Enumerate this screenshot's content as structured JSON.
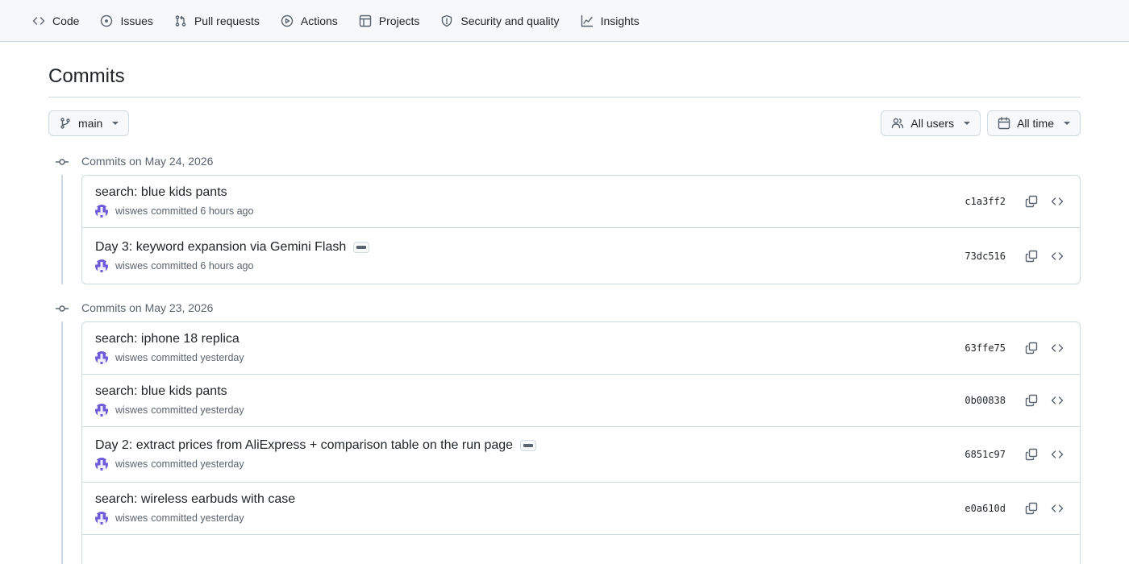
{
  "nav": {
    "items": [
      {
        "label": "Code",
        "icon": "code-icon"
      },
      {
        "label": "Issues",
        "icon": "issue-opened-icon"
      },
      {
        "label": "Pull requests",
        "icon": "git-pull-request-icon"
      },
      {
        "label": "Actions",
        "icon": "play-icon"
      },
      {
        "label": "Projects",
        "icon": "table-icon"
      },
      {
        "label": "Security and quality",
        "icon": "shield-icon"
      },
      {
        "label": "Insights",
        "icon": "graph-icon"
      }
    ]
  },
  "page": {
    "title": "Commits"
  },
  "toolbar": {
    "branch": "main",
    "users_filter": "All users",
    "time_filter": "All time"
  },
  "groups": [
    {
      "header": "Commits on May 24, 2026",
      "commits": [
        {
          "message": "search: blue kids pants",
          "author": "wiswes",
          "meta": "committed 6 hours ago",
          "sha": "c1a3ff2",
          "has_more": false
        },
        {
          "message": "Day 3: keyword expansion via Gemini Flash",
          "author": "wiswes",
          "meta": "committed 6 hours ago",
          "sha": "73dc516",
          "has_more": true
        }
      ]
    },
    {
      "header": "Commits on May 23, 2026",
      "commits": [
        {
          "message": "search: iphone 18 replica",
          "author": "wiswes",
          "meta": "committed yesterday",
          "sha": "63ffe75",
          "has_more": false
        },
        {
          "message": "search: blue kids pants",
          "author": "wiswes",
          "meta": "committed yesterday",
          "sha": "0b00838",
          "has_more": false
        },
        {
          "message": "Day 2: extract prices from AliExpress + comparison table on the run page",
          "author": "wiswes",
          "meta": "committed yesterday",
          "sha": "6851c97",
          "has_more": true
        },
        {
          "message": "search: wireless earbuds with case",
          "author": "wiswes",
          "meta": "committed yesterday",
          "sha": "e0a610d",
          "has_more": false
        }
      ]
    }
  ],
  "colors": {
    "accent_avatar": "#6e5bd9",
    "border": "#d1d9e0",
    "muted_text": "#59636e"
  }
}
